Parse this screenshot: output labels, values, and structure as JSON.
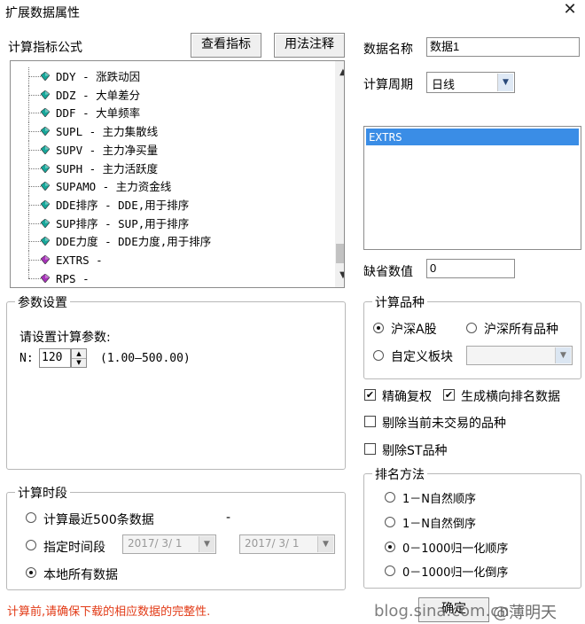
{
  "window": {
    "title": "扩展数据属性",
    "close_glyph": "✕"
  },
  "formula": {
    "label": "计算指标公式",
    "view_button": "查看指标",
    "usage_button": "用法注释",
    "items": [
      {
        "text": "DDY - 涨跌动因",
        "kind": "teal"
      },
      {
        "text": "DDZ - 大单差分",
        "kind": "teal"
      },
      {
        "text": "DDF - 大单频率",
        "kind": "teal"
      },
      {
        "text": "SUPL - 主力集散线",
        "kind": "teal"
      },
      {
        "text": "SUPV - 主力净买量",
        "kind": "teal"
      },
      {
        "text": "SUPH - 主力活跃度",
        "kind": "teal"
      },
      {
        "text": "SUPAMO - 主力资金线",
        "kind": "teal"
      },
      {
        "text": "DDE排序 - DDE,用于排序",
        "kind": "teal"
      },
      {
        "text": "SUP排序 - SUP,用于排序",
        "kind": "teal"
      },
      {
        "text": "DDE力度 - DDE力度,用于排序",
        "kind": "teal"
      },
      {
        "text": "EXTRS -",
        "kind": "purple"
      },
      {
        "text": "RPS -",
        "kind": "purple"
      }
    ]
  },
  "params": {
    "legend": "参数设置",
    "prompt": "请设置计算参数:",
    "n_label": "N:",
    "n_value": "120",
    "n_range": "(1.00—500.00)"
  },
  "period_range": {
    "legend": "计算时段",
    "option1": "计算最近500条数据",
    "option2": "指定时间段",
    "option3": "本地所有数据",
    "selected": 3,
    "date_from": "2017/ 3/ 1",
    "date_to": "2017/ 3/ 1",
    "dash": "-"
  },
  "warning": "计算前,请确保下载的相应数据的完整性.",
  "data_name": {
    "label": "数据名称",
    "value": "数据1"
  },
  "cycle": {
    "label": "计算周期",
    "value": "日线"
  },
  "right_list": {
    "items": [
      "EXTRS"
    ]
  },
  "default_value": {
    "label": "缺省数值",
    "value": "0"
  },
  "variety": {
    "legend": "计算品种",
    "option1": "沪深A股",
    "option2": "沪深所有品种",
    "option3": "自定义板块",
    "selected": 1
  },
  "checks": {
    "exact_restore": {
      "label": "精确复权",
      "checked": true
    },
    "rank_data": {
      "label": "生成横向排名数据",
      "checked": true
    },
    "exclude_untraded": {
      "label": "剔除当前未交易的品种",
      "checked": false
    },
    "exclude_st": {
      "label": "剔除ST品种",
      "checked": false
    }
  },
  "ranking": {
    "legend": "排名方法",
    "option1": "1－N自然顺序",
    "option2": "1－N自然倒序",
    "option3": "0－1000归一化顺序",
    "option4": "0－1000归一化倒序",
    "selected": 3
  },
  "confirm_button": "确定",
  "watermark": {
    "url": "blog.sina.com.cn",
    "author": "@薄明天"
  },
  "colors": {
    "teal": "#17a79a",
    "purple": "#a632b8",
    "selection": "#3a8de6",
    "warning": "#e23a16"
  }
}
